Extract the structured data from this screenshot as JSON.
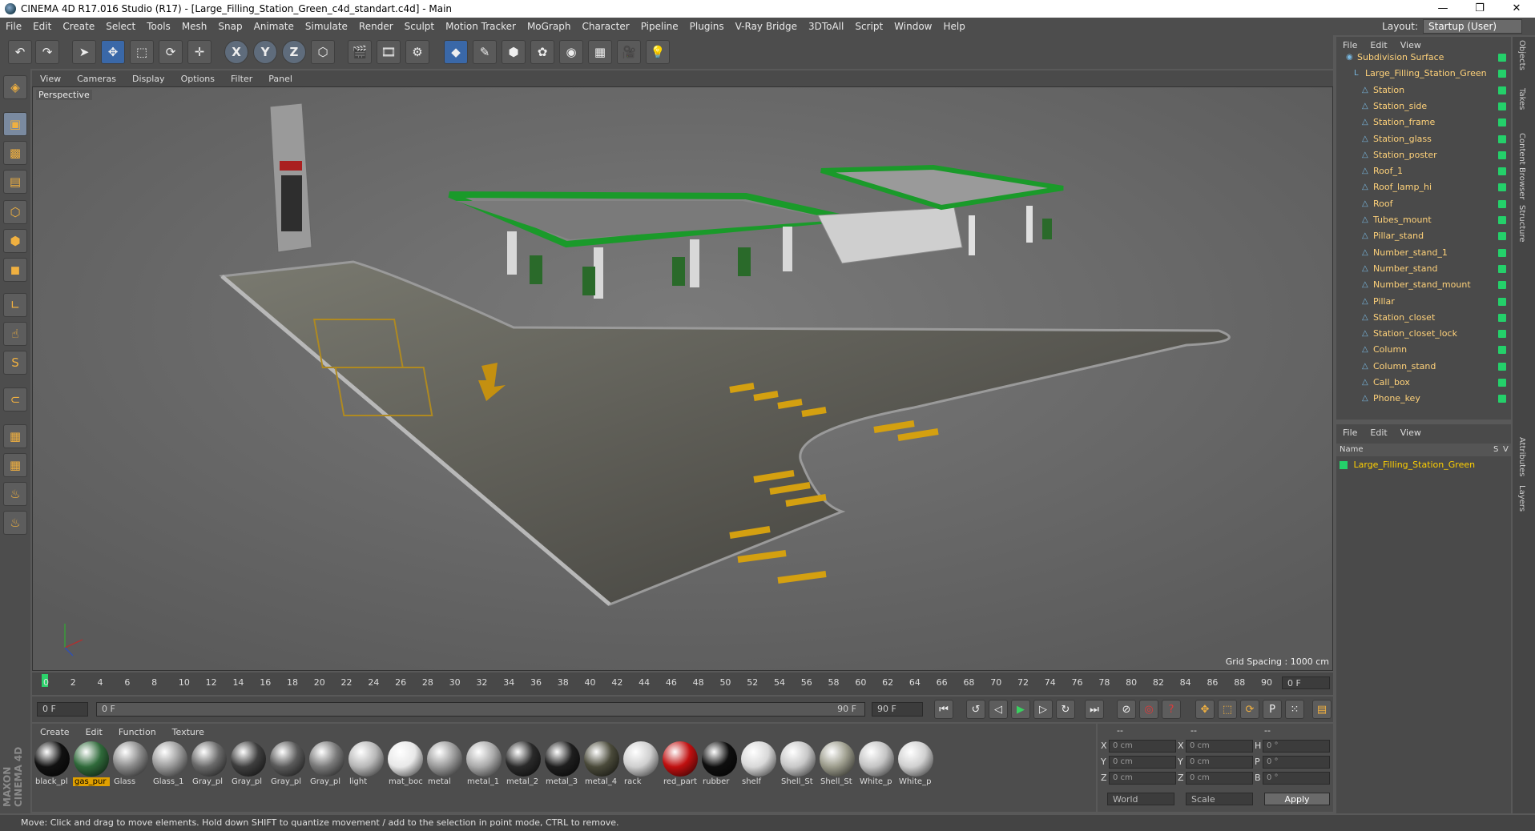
{
  "window": {
    "title": "CINEMA 4D R17.016 Studio (R17) - [Large_Filling_Station_Green_c4d_standart.c4d] - Main",
    "controls": [
      "—",
      "❐",
      "✕"
    ]
  },
  "menubar": {
    "items": [
      "File",
      "Edit",
      "Create",
      "Select",
      "Tools",
      "Mesh",
      "Snap",
      "Animate",
      "Simulate",
      "Render",
      "Sculpt",
      "Motion Tracker",
      "MoGraph",
      "Character",
      "Pipeline",
      "Plugins",
      "V-Ray Bridge",
      "3DToAll",
      "Script",
      "Window",
      "Help"
    ],
    "layout_label": "Layout:",
    "layout_value": "Startup (User)"
  },
  "toolbar": {
    "axis_x": "X",
    "axis_y": "Y",
    "axis_z": "Z"
  },
  "viewport": {
    "menu": [
      "View",
      "Cameras",
      "Display",
      "Options",
      "Filter",
      "Panel"
    ],
    "label": "Perspective",
    "grid_spacing": "Grid Spacing : 1000 cm"
  },
  "timeline": {
    "ticks": [
      "0",
      "2",
      "4",
      "6",
      "8",
      "10",
      "12",
      "14",
      "16",
      "18",
      "20",
      "22",
      "24",
      "26",
      "28",
      "30",
      "32",
      "34",
      "36",
      "38",
      "40",
      "42",
      "44",
      "46",
      "48",
      "50",
      "52",
      "54",
      "56",
      "58",
      "60",
      "62",
      "64",
      "66",
      "68",
      "70",
      "72",
      "74",
      "76",
      "78",
      "80",
      "82",
      "84",
      "86",
      "88",
      "90"
    ],
    "current_frame": "0 F",
    "start_frame": "0 F",
    "range_start": "0 F",
    "range_end": "90 F",
    "end_frame": "90 F"
  },
  "materials": {
    "menu": [
      "Create",
      "Edit",
      "Function",
      "Texture"
    ],
    "items": [
      {
        "name": "black_pl",
        "color": "#111111",
        "highlight": false
      },
      {
        "name": "gas_pur",
        "color": "#2f6a3a",
        "highlight": true
      },
      {
        "name": "Glass",
        "color": "#8a8a8a",
        "highlight": false
      },
      {
        "name": "Glass_1",
        "color": "#9a9a9a",
        "highlight": false
      },
      {
        "name": "Gray_pl",
        "color": "#6a6a6a",
        "highlight": false
      },
      {
        "name": "Gray_pl",
        "color": "#3e3e3e",
        "highlight": false
      },
      {
        "name": "Gray_pl",
        "color": "#5a5a5a",
        "highlight": false
      },
      {
        "name": "Gray_pl",
        "color": "#7a7a7a",
        "highlight": false
      },
      {
        "name": "light",
        "color": "#b8b8b8",
        "highlight": false
      },
      {
        "name": "mat_boc",
        "color": "#e8e8e8",
        "highlight": false
      },
      {
        "name": "metal",
        "color": "#9a9a9a",
        "highlight": false
      },
      {
        "name": "metal_1",
        "color": "#aaaaaa",
        "highlight": false
      },
      {
        "name": "metal_2",
        "color": "#2a2a2a",
        "highlight": false
      },
      {
        "name": "metal_3",
        "color": "#1e1e1e",
        "highlight": false
      },
      {
        "name": "metal_4",
        "color": "#4a4a3a",
        "highlight": false
      },
      {
        "name": "rack",
        "color": "#cfcfcf",
        "highlight": false
      },
      {
        "name": "red_part",
        "color": "#c01010",
        "highlight": false
      },
      {
        "name": "rubber",
        "color": "#0e0e0e",
        "highlight": false
      },
      {
        "name": "shelf",
        "color": "#d8d8d8",
        "highlight": false
      },
      {
        "name": "Shell_St",
        "color": "#c8c8c8",
        "highlight": false
      },
      {
        "name": "Shell_St",
        "color": "#9c9c8c",
        "highlight": false
      },
      {
        "name": "White_p",
        "color": "#c4c4c4",
        "highlight": false
      },
      {
        "name": "White_p",
        "color": "#d0d0d0",
        "highlight": false
      }
    ]
  },
  "coords": {
    "header": [
      "--",
      "--",
      "--"
    ],
    "rows": [
      {
        "a": "X",
        "v1": "0 cm",
        "b": "X",
        "v2": "0 cm",
        "c": "H",
        "v3": "0 °"
      },
      {
        "a": "Y",
        "v1": "0 cm",
        "b": "Y",
        "v2": "0 cm",
        "c": "P",
        "v3": "0 °"
      },
      {
        "a": "Z",
        "v1": "0 cm",
        "b": "Z",
        "v2": "0 cm",
        "c": "B",
        "v3": "0 °"
      }
    ],
    "world": "World",
    "scale": "Scale",
    "apply": "Apply"
  },
  "objects": {
    "menu": [
      "File",
      "Edit",
      "View"
    ],
    "items": [
      {
        "name": "Subdivision Surface",
        "level": 0
      },
      {
        "name": "Large_Filling_Station_Green",
        "level": 1
      },
      {
        "name": "Station",
        "level": 2
      },
      {
        "name": "Station_side",
        "level": 2
      },
      {
        "name": "Station_frame",
        "level": 2
      },
      {
        "name": "Station_glass",
        "level": 2
      },
      {
        "name": "Station_poster",
        "level": 2
      },
      {
        "name": "Roof_1",
        "level": 2
      },
      {
        "name": "Roof_lamp_hi",
        "level": 2
      },
      {
        "name": "Roof",
        "level": 2
      },
      {
        "name": "Tubes_mount",
        "level": 2
      },
      {
        "name": "Pillar_stand",
        "level": 2
      },
      {
        "name": "Number_stand_1",
        "level": 2
      },
      {
        "name": "Number_stand",
        "level": 2
      },
      {
        "name": "Number_stand_mount",
        "level": 2
      },
      {
        "name": "Pillar",
        "level": 2
      },
      {
        "name": "Station_closet",
        "level": 2
      },
      {
        "name": "Station_closet_lock",
        "level": 2
      },
      {
        "name": "Column",
        "level": 2
      },
      {
        "name": "Column_stand",
        "level": 2
      },
      {
        "name": "Call_box",
        "level": 2
      },
      {
        "name": "Phone_key",
        "level": 2
      }
    ]
  },
  "layers": {
    "menu": [
      "File",
      "Edit",
      "View"
    ],
    "col_name": "Name",
    "col_s": "S",
    "col_v": "V",
    "item": "Large_Filling_Station_Green"
  },
  "right_tabs": [
    "Objects",
    "Takes",
    "Content Browser",
    "Structure",
    "Attributes",
    "Layers"
  ],
  "brand": "MAXON CINEMA 4D",
  "status": "Move: Click and drag to move elements. Hold down SHIFT to quantize movement / add to the selection in point mode, CTRL to remove."
}
